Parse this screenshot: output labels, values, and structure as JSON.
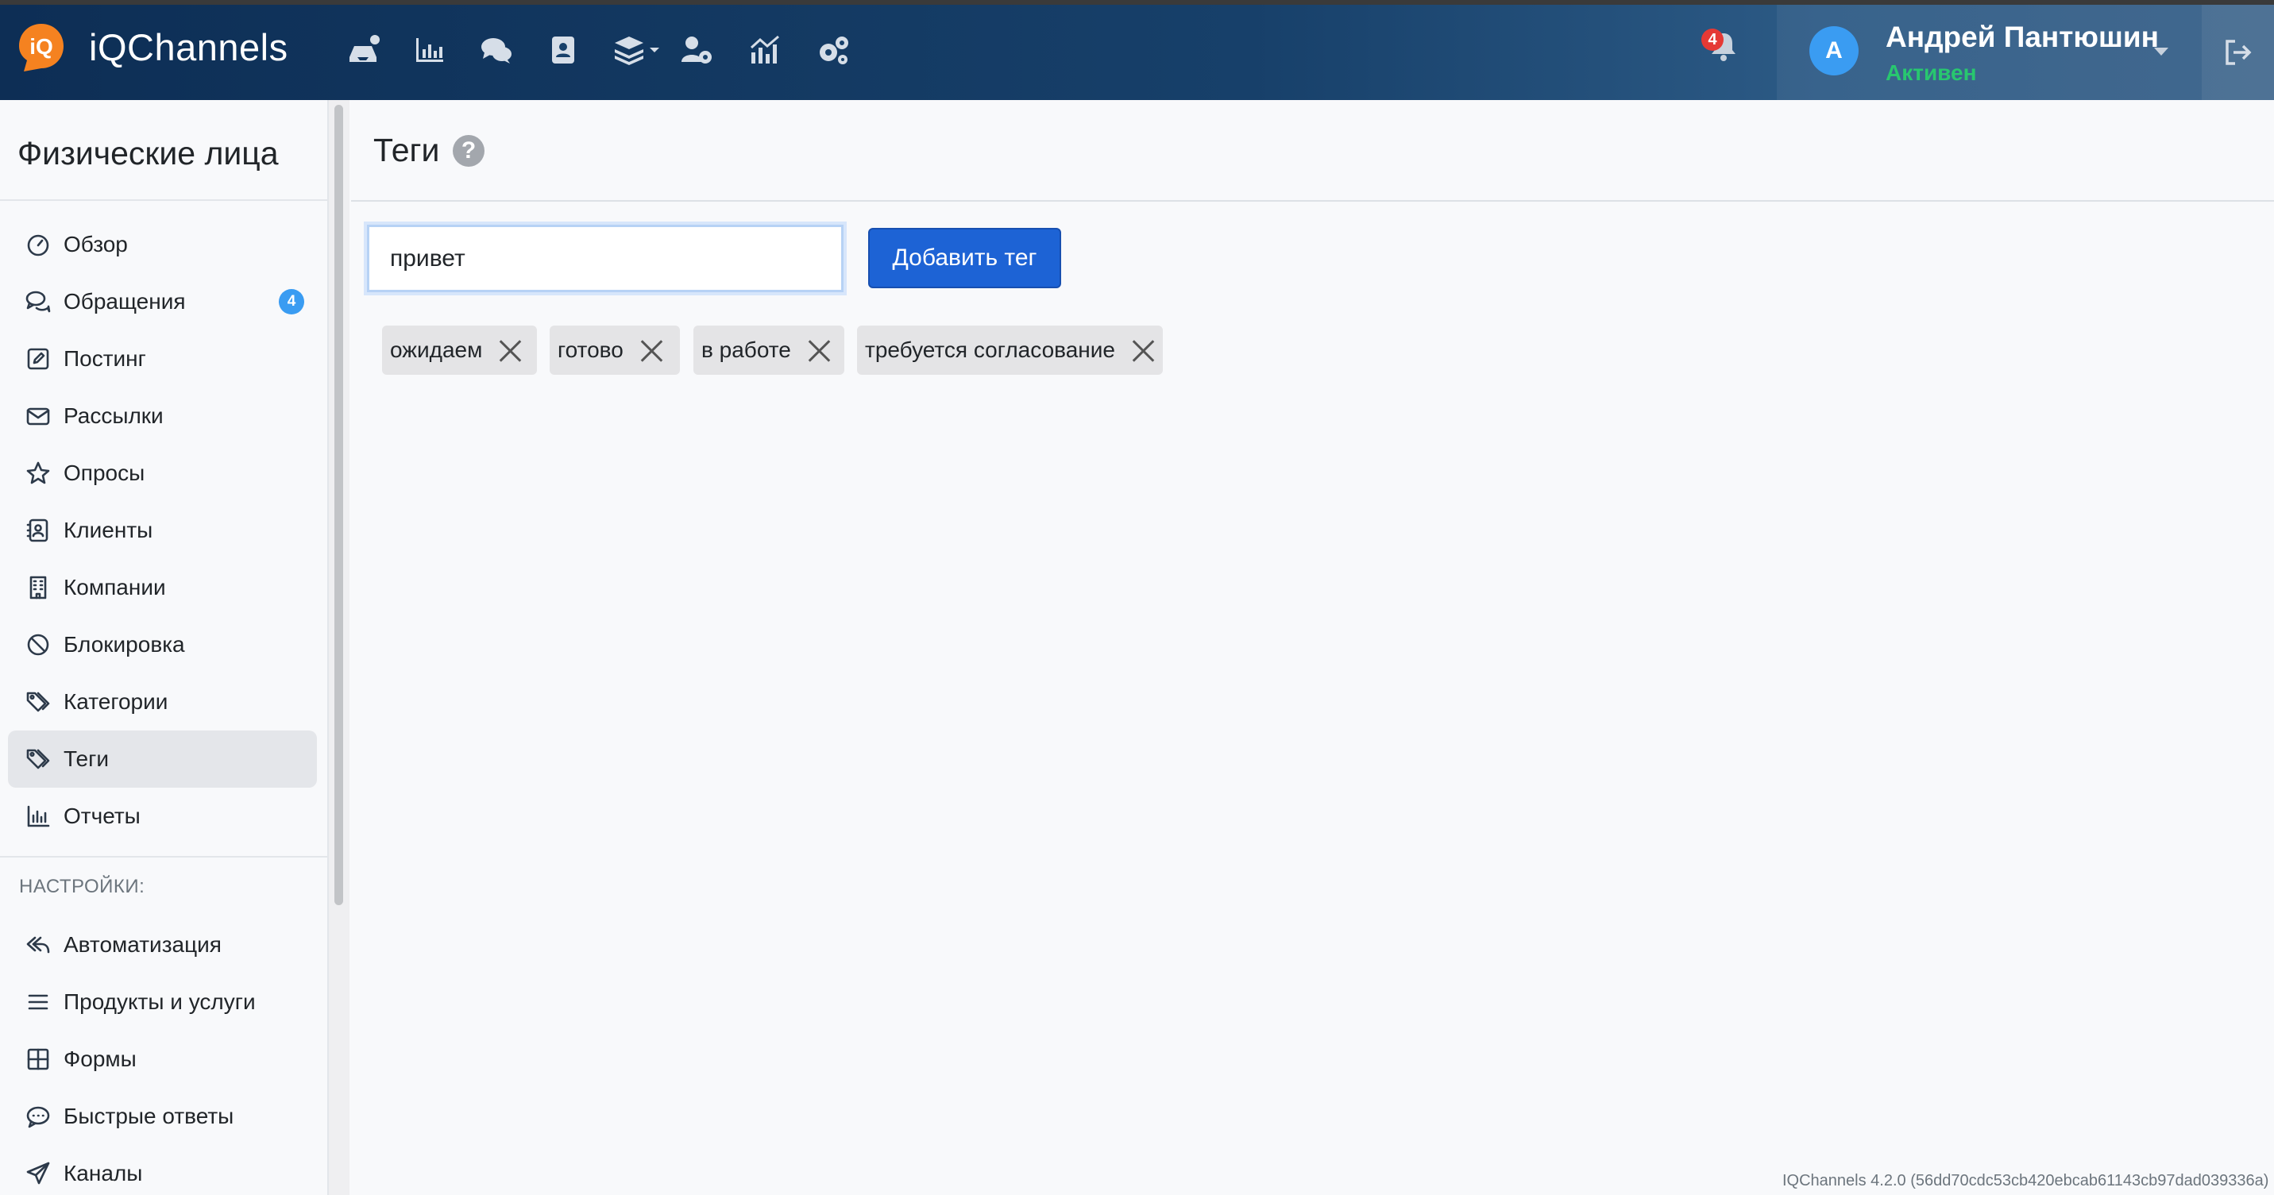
{
  "app": {
    "brand": "iQChannels",
    "logo_text": "iQ"
  },
  "header": {
    "nav_icons": [
      "inbox-icon",
      "chart-icon",
      "chat-icon",
      "contacts-icon",
      "layers-icon",
      "user-settings-icon",
      "analytics-icon",
      "gears-icon"
    ],
    "notifications_count": "4",
    "user": {
      "initial": "А",
      "name": "Андрей Пантюшин",
      "status": "Активен"
    }
  },
  "sidebar": {
    "title": "Физические лица",
    "items": [
      {
        "label": "Обзор",
        "icon": "dashboard-icon"
      },
      {
        "label": "Обращения",
        "icon": "comments-icon",
        "badge": "4"
      },
      {
        "label": "Постинг",
        "icon": "edit-icon"
      },
      {
        "label": "Рассылки",
        "icon": "envelope-icon"
      },
      {
        "label": "Опросы",
        "icon": "star-icon"
      },
      {
        "label": "Клиенты",
        "icon": "contact-card-icon"
      },
      {
        "label": "Компании",
        "icon": "building-icon"
      },
      {
        "label": "Блокировка",
        "icon": "ban-icon"
      },
      {
        "label": "Категории",
        "icon": "tags-icon"
      },
      {
        "label": "Теги",
        "icon": "tags-icon",
        "active": true
      },
      {
        "label": "Отчеты",
        "icon": "bar-chart-icon"
      }
    ],
    "settings_heading": "НАСТРОЙКИ:",
    "settings_items": [
      {
        "label": "Автоматизация",
        "icon": "reply-all-icon"
      },
      {
        "label": "Продукты и услуги",
        "icon": "list-icon"
      },
      {
        "label": "Формы",
        "icon": "grid-icon"
      },
      {
        "label": "Быстрые ответы",
        "icon": "comment-dots-icon"
      },
      {
        "label": "Каналы",
        "icon": "paper-plane-icon"
      }
    ]
  },
  "main": {
    "title": "Теги",
    "tag_input_value": "привет",
    "add_button_label": "Добавить тег",
    "tags": [
      "ожидаем",
      "готово",
      "в работе",
      "требуется согласование"
    ]
  },
  "footer": {
    "version": "IQChannels 4.2.0 (56dd70cdc53cb420ebcab61143cb97dad039336a)"
  },
  "colors": {
    "accent": "#1d63d5",
    "status_active": "#28c76f",
    "badge": "#3a9cf2",
    "logo": "#f58220"
  }
}
